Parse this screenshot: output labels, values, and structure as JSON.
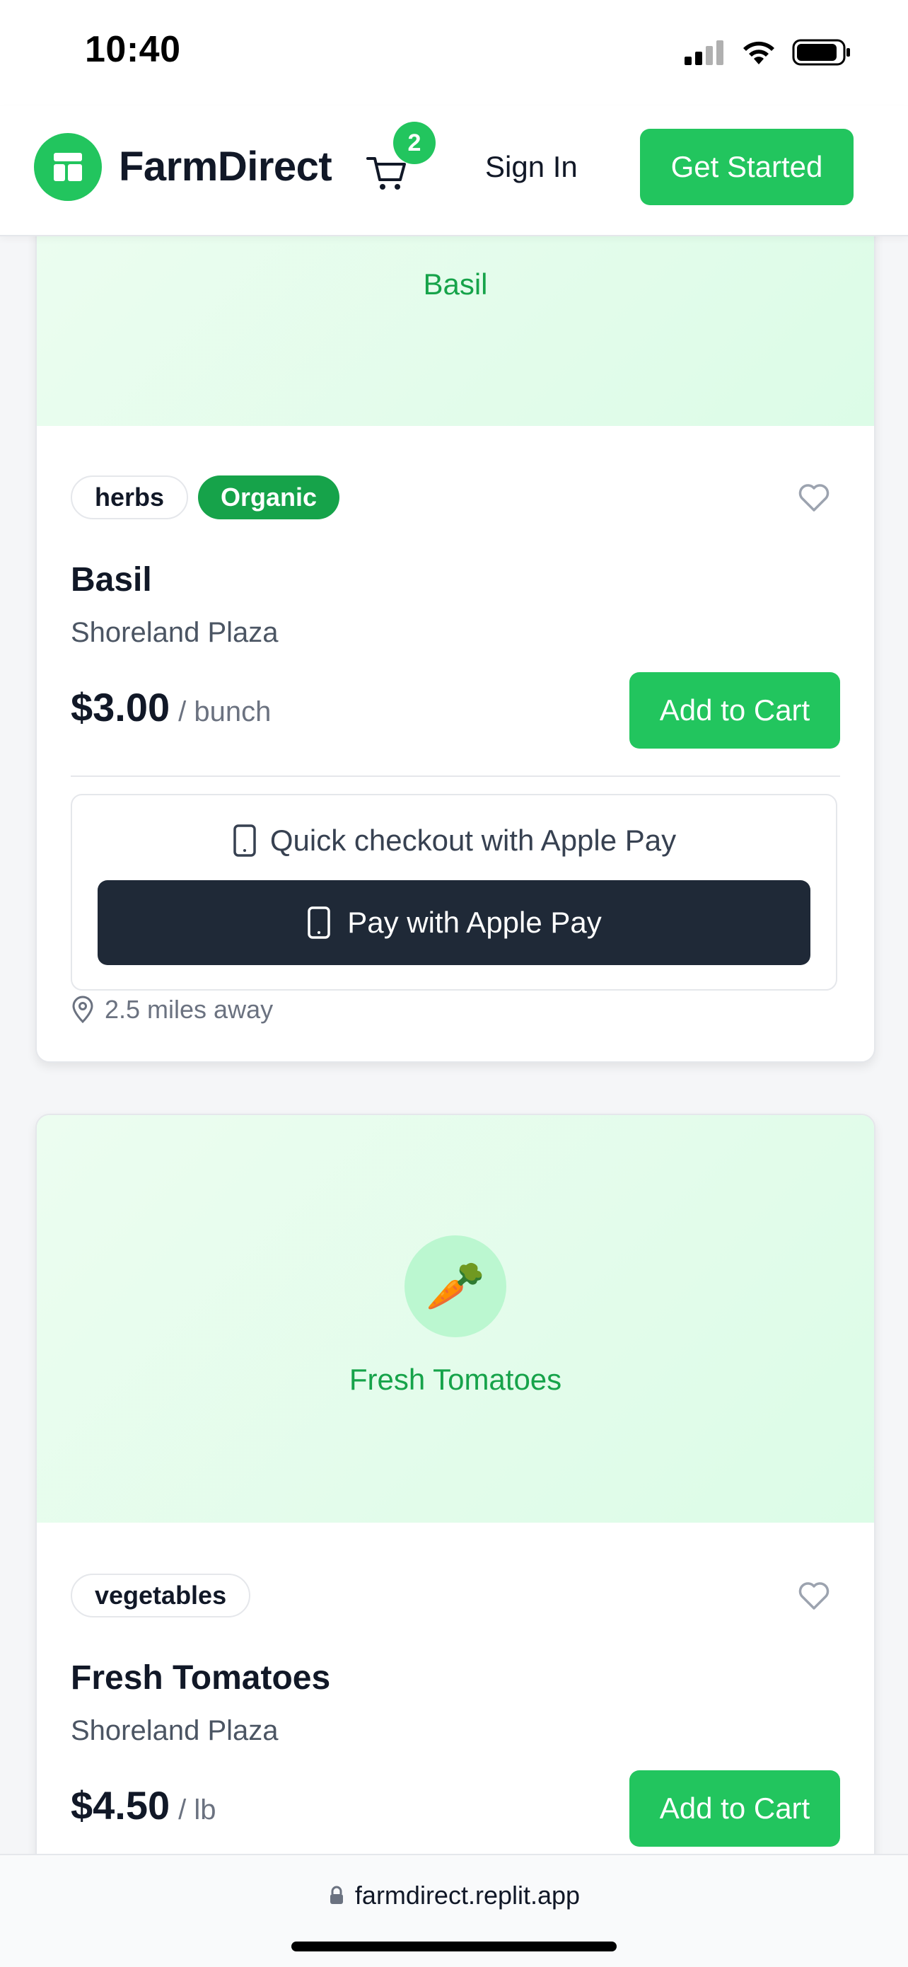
{
  "status_bar": {
    "time": "10:40"
  },
  "header": {
    "brand": "FarmDirect",
    "cart_count": "2",
    "sign_in_label": "Sign In",
    "get_started_label": "Get Started"
  },
  "products": [
    {
      "hero_label": "Basil",
      "tags": [
        "herbs",
        "Organic"
      ],
      "name": "Basil",
      "location": "Shoreland Plaza",
      "price": "$3.00",
      "unit": "/ bunch",
      "add_to_cart_label": "Add to Cart",
      "quick_checkout_label": "Quick checkout with Apple Pay",
      "apple_pay_label": "Pay with Apple Pay",
      "distance": "2.5 miles away"
    },
    {
      "hero_emoji": "🥕",
      "hero_label": "Fresh Tomatoes",
      "tags": [
        "vegetables"
      ],
      "name": "Fresh Tomatoes",
      "location": "Shoreland Plaza",
      "price": "$4.50",
      "unit": "/ lb",
      "add_to_cart_label": "Add to Cart"
    }
  ],
  "browser": {
    "url": "farmdirect.replit.app"
  },
  "colors": {
    "accent": "#22c55e",
    "accent_dark": "#16a34a",
    "hero_bg": "#dcfce7",
    "apple_pay_bg": "#1f2937"
  }
}
